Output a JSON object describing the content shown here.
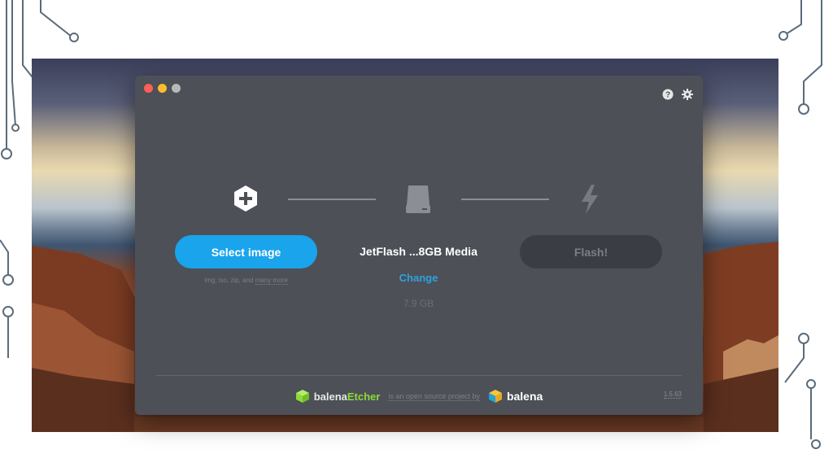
{
  "window": {
    "traffic_lights": [
      "close",
      "minimize",
      "zoom"
    ],
    "top_icons": [
      "help-icon",
      "gear-icon"
    ]
  },
  "steps": {
    "image": {
      "icon": "plus-hexagon-icon",
      "button_label": "Select image",
      "hint_prefix": "img, iso, zip, and",
      "hint_link": "many more"
    },
    "drive": {
      "icon": "drive-icon",
      "name": "JetFlash ...8GB Media",
      "change_label": "Change",
      "size": "7.9 GB"
    },
    "flash": {
      "icon": "lightning-icon",
      "button_label": "Flash!",
      "enabled": false
    }
  },
  "footer": {
    "brand_prefix": "balena",
    "brand_suffix": "Etcher",
    "tagline": "is an open source project by",
    "company": "balena",
    "version": "1.5.63"
  },
  "colors": {
    "window_bg": "#4d5057",
    "primary": "#1aa4ec",
    "link": "#2fa2e0",
    "etcher_green": "#8ddb3a"
  }
}
